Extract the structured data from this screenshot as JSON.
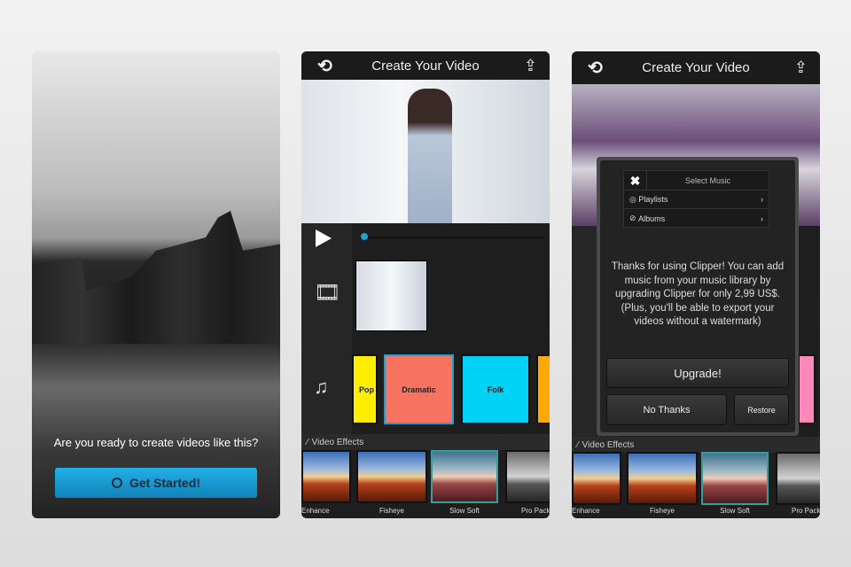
{
  "screen1": {
    "prompt": "Are you ready to create videos like this?",
    "cta_label": "Get Started!",
    "cta_icon": "play-circle-icon",
    "accent": "#1a9fd6"
  },
  "screen2": {
    "title": "Create Your Video",
    "back_icon": "back-arrow-icon",
    "share_icon": "share-icon",
    "music_tiles": [
      {
        "label": "Pop",
        "color": "#ffee00"
      },
      {
        "label": "Dramatic",
        "color": "#f97460"
      },
      {
        "label": "Folk",
        "color": "#00d2f5"
      },
      {
        "label": "",
        "color": "#ffaa00"
      }
    ],
    "effects_label": "Video Effects",
    "effects": [
      {
        "label": "Enhance"
      },
      {
        "label": "Fisheye"
      },
      {
        "label": "Slow Soft"
      },
      {
        "label": "Pro Pack"
      }
    ]
  },
  "screen3": {
    "title": "Create Your Video",
    "dialog": {
      "select_music": "Select Music",
      "playlists": "Playlists",
      "albums": "Albums",
      "message": "Thanks for using Clipper!  You can add music from your music library by upgrading Clipper for only 2,99 US$. (Plus, you'll be able to export your videos without a watermark)",
      "upgrade": "Upgrade!",
      "no_thanks": "No Thanks",
      "restore": "Restore"
    },
    "effects_label": "Video Effects",
    "effects": [
      {
        "label": "Enhance"
      },
      {
        "label": "Fisheye"
      },
      {
        "label": "Slow Soft"
      },
      {
        "label": "Pro Pack"
      }
    ]
  }
}
